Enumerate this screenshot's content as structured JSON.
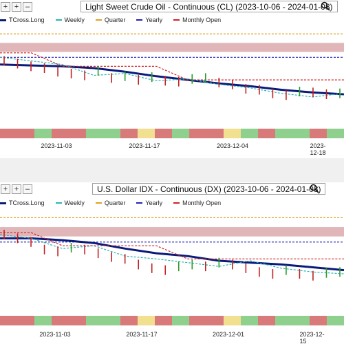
{
  "toolbar": {
    "buttons": [
      "+",
      "+",
      "–"
    ]
  },
  "legend": [
    {
      "label": "TCross.Long",
      "color": "#0a1a7a",
      "style": "solid"
    },
    {
      "label": "Weekly",
      "color": "#2bb3b3",
      "style": "dashed"
    },
    {
      "label": "Quarter",
      "color": "#e0a020",
      "style": "dashed"
    },
    {
      "label": "Yearly",
      "color": "#2020c0",
      "style": "dashed"
    },
    {
      "label": "Monthly Open",
      "color": "#d02020",
      "style": "dashed"
    }
  ],
  "panels": [
    {
      "title": "Light Sweet Crude Oil - Continuous (CL) (2023-10-06 - 2024-01-08)",
      "x_ticks": [
        "2023-11-03",
        "2023-11-17",
        "2023-12-04",
        "2023-12-18"
      ]
    },
    {
      "title": "U.S. Dollar IDX - Continuous (DX) (2023-10-06 - 2024-01-08)",
      "x_ticks": [
        "2023-11-03",
        "2023-11-17",
        "2023-12-01",
        "2023-12-15"
      ]
    }
  ],
  "chart_data": [
    {
      "type": "line",
      "title": "Light Sweet Crude Oil - Continuous (CL) (2023-10-06 - 2024-01-08)",
      "x_ticks": [
        "2023-11-03",
        "2023-11-17",
        "2023-12-04",
        "2023-12-18"
      ],
      "series": [
        {
          "name": "TCross.Long",
          "values": [
            0.62,
            0.61,
            0.6,
            0.58,
            0.54,
            0.49,
            0.45,
            0.41,
            0.38,
            0.34,
            0.31,
            0.29
          ]
        },
        {
          "name": "Weekly",
          "values": [
            0.7,
            0.66,
            0.62,
            0.5,
            0.52,
            0.44,
            0.46,
            0.4,
            0.36,
            0.3,
            0.26,
            0.3
          ]
        },
        {
          "name": "Monthly Open",
          "values": [
            0.75,
            0.75,
            0.6,
            0.6,
            0.6,
            0.6,
            0.45,
            0.45,
            0.45,
            0.45,
            0.45,
            0.45
          ]
        }
      ],
      "price": [
        0.66,
        0.63,
        0.6,
        0.58,
        0.54,
        0.52,
        0.5,
        0.55,
        0.47,
        0.49,
        0.45,
        0.48,
        0.44,
        0.43,
        0.46,
        0.47,
        0.42,
        0.4,
        0.35,
        0.34,
        0.3,
        0.28,
        0.32,
        0.31,
        0.29,
        0.3
      ]
    },
    {
      "type": "line",
      "title": "U.S. Dollar IDX - Continuous (DX) (2023-10-06 - 2024-01-08)",
      "x_ticks": [
        "2023-11-03",
        "2023-11-17",
        "2023-12-01",
        "2023-12-15"
      ],
      "series": [
        {
          "name": "TCross.Long",
          "values": [
            0.74,
            0.74,
            0.72,
            0.69,
            0.63,
            0.58,
            0.55,
            0.5,
            0.48,
            0.46,
            0.43,
            0.4
          ]
        },
        {
          "name": "Weekly",
          "values": [
            0.78,
            0.74,
            0.63,
            0.66,
            0.55,
            0.52,
            0.48,
            0.44,
            0.5,
            0.42,
            0.38,
            0.36
          ]
        },
        {
          "name": "Monthly Open",
          "values": [
            0.8,
            0.8,
            0.66,
            0.66,
            0.66,
            0.66,
            0.52,
            0.52,
            0.52,
            0.52,
            0.52,
            0.52
          ]
        }
      ],
      "price": [
        0.78,
        0.74,
        0.7,
        0.62,
        0.6,
        0.64,
        0.62,
        0.58,
        0.54,
        0.52,
        0.46,
        0.42,
        0.4,
        0.44,
        0.46,
        0.44,
        0.48,
        0.46,
        0.42,
        0.38,
        0.36,
        0.4,
        0.36,
        0.34,
        0.37,
        0.38
      ]
    }
  ]
}
